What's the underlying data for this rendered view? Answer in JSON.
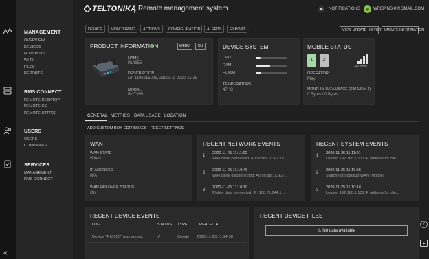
{
  "app": {
    "logo": "TELTONIKA",
    "title": "Remote management system"
  },
  "header": {
    "notifications": "NOTIFICATIONS",
    "user_email": "WREPINSKI@GMAIL.COM"
  },
  "sidebar": {
    "sections": [
      {
        "title": "MANAGEMENT",
        "items": [
          "OVERVIEW",
          "DEVICES",
          "HOTSPOTS",
          "WI-FI",
          "FILES",
          "REPORTS"
        ]
      },
      {
        "title": "RMS CONNECT",
        "items": [
          "REMOTE DESKTOP",
          "REMOTE SSH",
          "REMOTE HTTP(S)"
        ]
      },
      {
        "title": "USERS",
        "items": [
          "USERS",
          "COMPANIES"
        ]
      },
      {
        "title": "SERVICES",
        "items": [
          "MANAGEMENT",
          "RMS CONNECT"
        ]
      }
    ],
    "collapse": "«"
  },
  "toolbar": {
    "menus": [
      "DEVICE",
      "MONITORING",
      "ACTIONS",
      "CONFIGURATION",
      "ALERTS",
      "EXPORT"
    ],
    "view_history": "VIEW UPDATE HISTORY",
    "update_info": "UPDATE INFORMATION"
  },
  "product": {
    "title": "PRODUCT INFORMATION",
    "webui": "WEBUI",
    "cli": "CLI",
    "name_label": "NAME",
    "name": "RUt955",
    "desc_label": "DESCRIPTION",
    "desc": "s/n 1106215091, added at 2020-11-25",
    "model_label": "MODEL",
    "model": "RUT955",
    "status_color": "#4caf50"
  },
  "device_system": {
    "title": "DEVICE SYSTEM",
    "cpu_label": "CPU",
    "cpu": 0.15,
    "ram_label": "RAM",
    "ram": 0.45,
    "flash_label": "FLASH",
    "flash": 0.18,
    "temp_label": "TEMPERATURE",
    "temp": "47 °C"
  },
  "mobile": {
    "title": "MOBILE STATUS",
    "sim1": "1",
    "sim2": "2",
    "signal": "-49 dBm",
    "operator_label": "OPERATOR",
    "operator": "Play",
    "usage_label": "MONTHLY DATA USAGE (SIM 1/SIM 2)",
    "usage": "0 Bytes / 0 Bytes",
    "sim_active_color": "#a5d6a7"
  },
  "tabs": [
    "GENERAL",
    "METRICS",
    "DATA USAGE",
    "LOCATION"
  ],
  "subtabs": [
    "ADD CUSTOM BOX",
    "EDIT BOXES",
    "RESET SETTINGS"
  ],
  "wan": {
    "title": "WAN",
    "state_label": "WAN STATE",
    "state": "Wired",
    "ip_label": "IP ADDRESS",
    "ip": "N/A",
    "failover_label": "WAN FAILOVER STATUS",
    "failover": "On"
  },
  "network_events": {
    "title": "RECENT NETWORK EVENTS",
    "items": [
      {
        "n": "1",
        "time": "2020-11-25 11:11:02",
        "desc": "WiFi client connected: A0:99:9B:1C:E2:75 ..."
      },
      {
        "n": "2",
        "time": "2020-11-25 11:10:46",
        "desc": "WiFi client disconnected: A0:99:9B:1C:E2:..."
      },
      {
        "n": "3",
        "time": "2020-11-25 11:10:19",
        "desc": "Mobile data connected, IP: 100.71.244.1 ..."
      }
    ]
  },
  "system_events": {
    "title": "RECENT SYSTEM EVENTS",
    "items": [
      {
        "n": "1",
        "time": "2020-11-25 11:11:01",
        "desc": "Leased 192.168.1.131 IP address for clie..."
      },
      {
        "n": "2",
        "time": "2020-11-25 11:10:55",
        "desc": "Switched to backup WAN (Mobile)"
      },
      {
        "n": "3",
        "time": "2020-11-25 11:10:16",
        "desc": "Leased 192.168.1.131 IP address for clie..."
      }
    ]
  },
  "device_events": {
    "title": "RECENT DEVICE EVENTS",
    "headers": [
      "LOG",
      "STATUS",
      "TYPE",
      "CREATED AT"
    ],
    "row": {
      "log": "Device \"RUt955\" was added.",
      "status": "✓",
      "type": "Create",
      "created": "2020-11-25 11:14:38"
    }
  },
  "device_files": {
    "title": "RECENT DEVICE FILES",
    "empty": "No data available"
  }
}
